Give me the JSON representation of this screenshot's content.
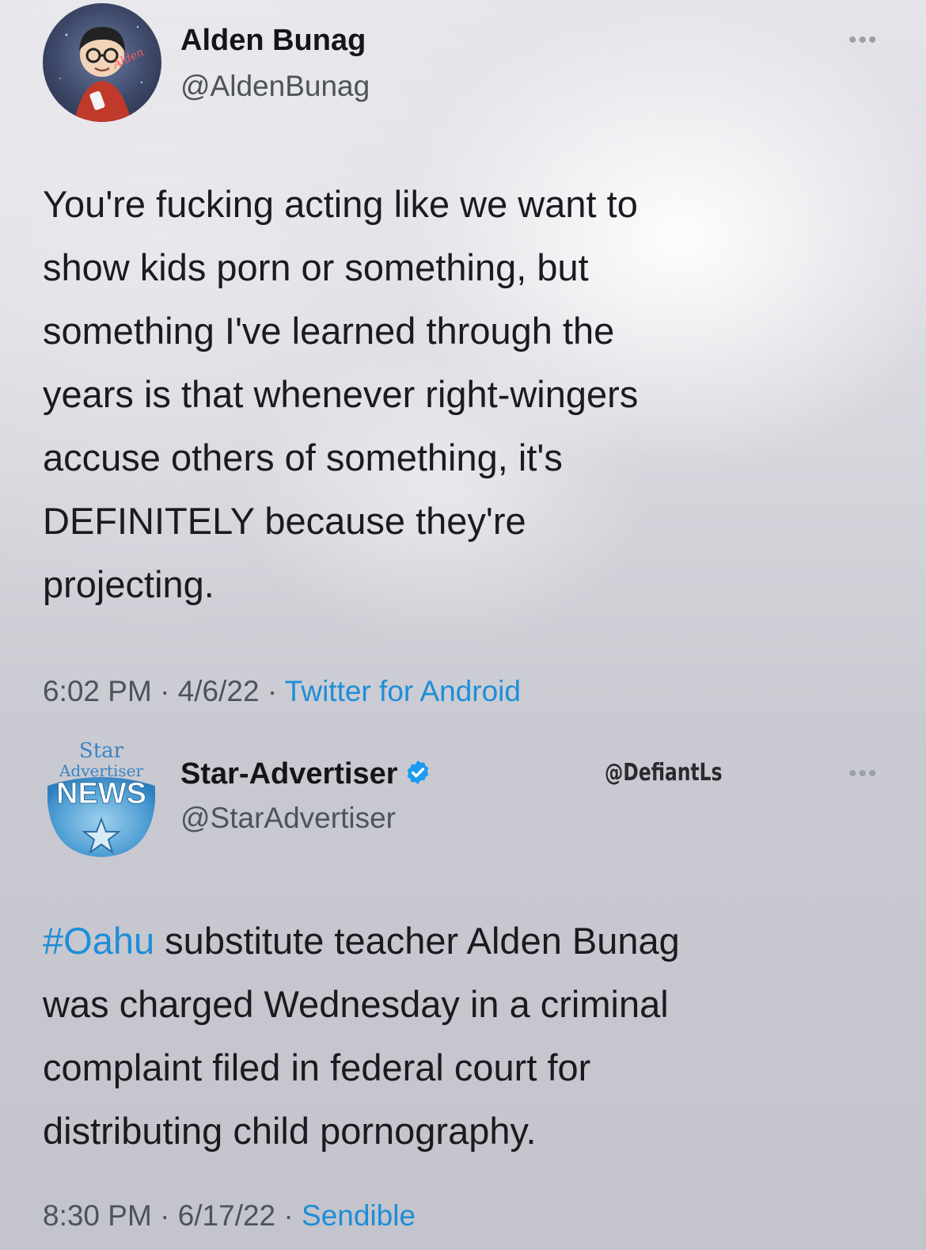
{
  "tweets": [
    {
      "display_name": "Alden Bunag",
      "handle": "@AldenBunag",
      "avatar_text": "Alden",
      "more_icon": "more-dots-icon",
      "text_lines": [
        "You're fucking acting like we want to",
        "show kids porn or something, but",
        "something I've learned through the",
        "years is that whenever right-wingers",
        "accuse others of something, it's",
        "DEFINITELY because they're",
        "projecting."
      ],
      "time": "6:02 PM",
      "separator": "·",
      "date": "4/6/22",
      "source": "Twitter for Android"
    },
    {
      "display_name": "Star-Advertiser",
      "handle": "@StarAdvertiser",
      "verified": true,
      "avatar_text": {
        "line1": "Star",
        "line2": "Advertiser",
        "line3": "NEWS"
      },
      "more_icon": "more-dots-icon",
      "hashtag": "#Oahu",
      "text_lines": [
        " substitute teacher Alden Bunag",
        "was charged Wednesday in a criminal",
        "complaint filed in federal court for",
        "distributing child pornography."
      ],
      "time": "8:30 PM",
      "separator": "·",
      "date": "6/17/22",
      "source": "Sendible"
    }
  ],
  "watermark": "@DefiantLs",
  "colors": {
    "link": "#1d8ed8",
    "text": "#1a1a1f",
    "muted": "#4d5359",
    "verified": "#1d9bf0"
  }
}
